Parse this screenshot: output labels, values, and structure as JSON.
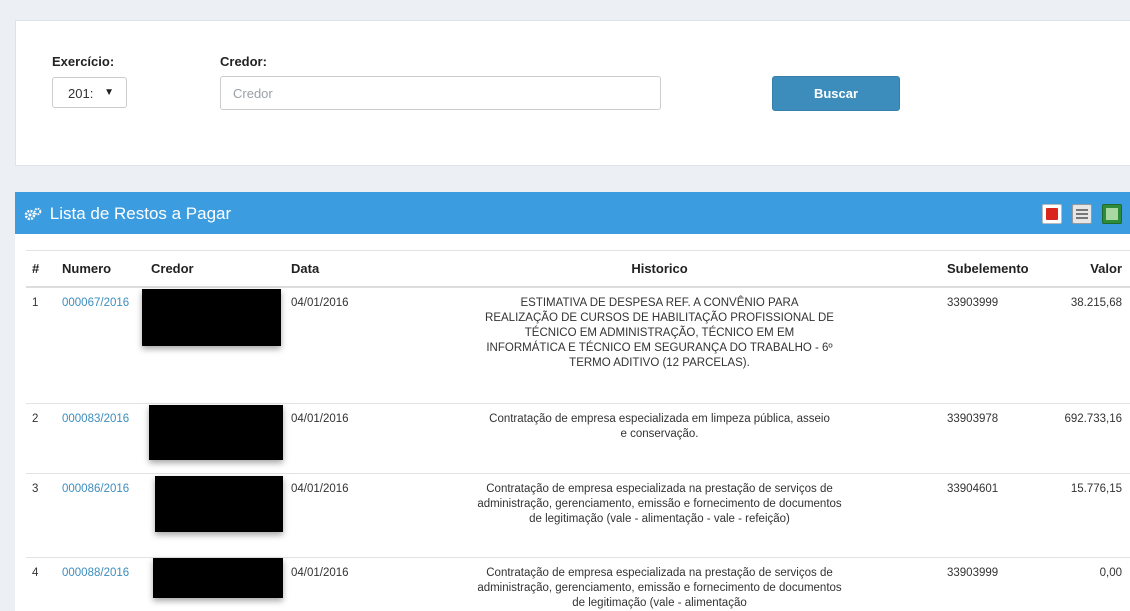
{
  "filters": {
    "exercicio_label": "Exercício:",
    "exercicio_value": "201:",
    "credor_label": "Credor:",
    "credor_placeholder": "Credor",
    "buscar_label": "Buscar"
  },
  "list": {
    "title": "Lista de Restos a Pagar",
    "icons": [
      "gear-icon",
      "pdf-icon",
      "document-icon",
      "excel-icon"
    ],
    "columns": [
      "#",
      "Numero",
      "Credor",
      "Data",
      "Historico",
      "Subelemento",
      "Valor"
    ],
    "rows": [
      {
        "idx": "1",
        "numero": "000067/2016",
        "data": "04/01/2016",
        "historico": "ESTIMATIVA DE DESPESA REF. A CONVÊNIO PARA REALIZAÇÃO DE CURSOS DE HABILITAÇÃO PROFISSIONAL DE TÉCNICO EM ADMINISTRAÇÃO, TÉCNICO EM EM INFORMÁTICA E TÉCNICO EM SEGURANÇA DO TRABALHO - 6º TERMO ADITIVO (12 PARCELAS).",
        "subelemento": "33903999",
        "valor": "38.215,68"
      },
      {
        "idx": "2",
        "numero": "000083/2016",
        "data": "04/01/2016",
        "historico": "Contratação de empresa especializada em limpeza pública, asseio e conservação.",
        "subelemento": "33903978",
        "valor": "692.733,16"
      },
      {
        "idx": "3",
        "numero": "000086/2016",
        "data": "04/01/2016",
        "historico": "Contratação de empresa especializada na prestação de serviços de administração, gerenciamento, emissão e fornecimento de documentos de legitimação (vale - alimentação - vale - refeição)",
        "subelemento": "33904601",
        "valor": "15.776,15"
      },
      {
        "idx": "4",
        "numero": "000088/2016",
        "data": "04/01/2016",
        "historico": "Contratação de empresa especializada na prestação de serviços de administração, gerenciamento, emissão e fornecimento de documentos de legitimação (vale - alimentação",
        "subelemento": "33903999",
        "valor": "0,00"
      }
    ]
  },
  "colors": {
    "header_blue": "#3c9ce0",
    "button_blue": "#3c8dbc",
    "link_blue": "#3c8dbc",
    "background": "#ecf0f5"
  }
}
